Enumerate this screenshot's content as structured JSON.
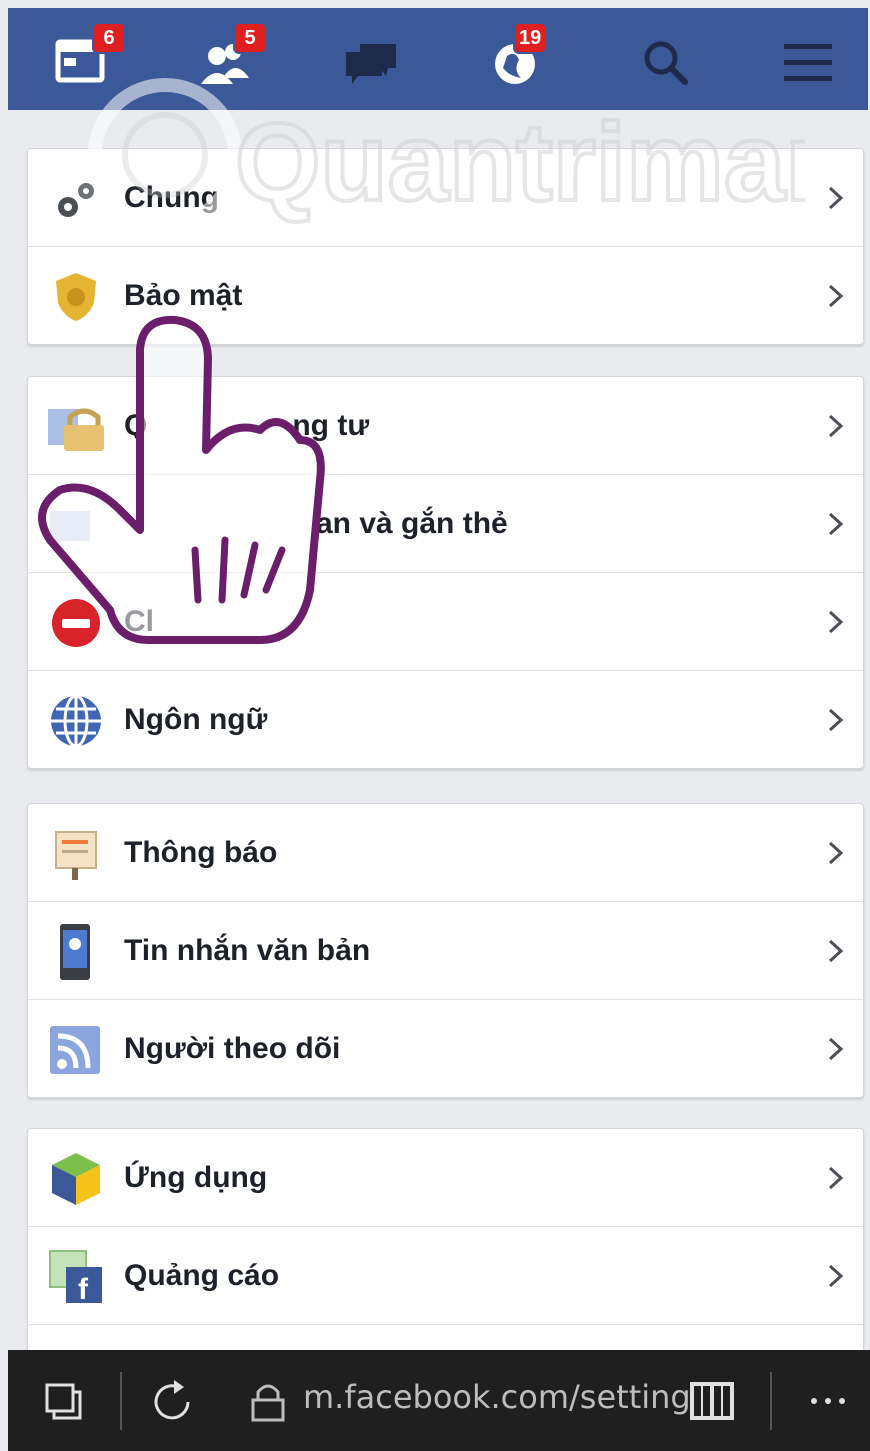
{
  "header": {
    "background": "#3b5998",
    "icons": [
      {
        "name": "news-feed-icon",
        "badge": "6"
      },
      {
        "name": "friend-requests-icon",
        "badge": "5"
      },
      {
        "name": "messages-icon",
        "badge": ""
      },
      {
        "name": "notifications-globe-icon",
        "badge": "19"
      },
      {
        "name": "search-icon",
        "badge": ""
      },
      {
        "name": "menu-icon",
        "badge": ""
      }
    ]
  },
  "watermark": {
    "text": "Quantrimang"
  },
  "settings_groups": [
    {
      "items": [
        {
          "label": "Chung",
          "icon": "gears-icon"
        },
        {
          "label": "Bảo mật",
          "icon": "security-badge-icon"
        }
      ]
    },
    {
      "items": [
        {
          "label": "Q",
          "extra": "ng tư",
          "icon": "privacy-lock-icon"
        },
        {
          "label": "an và gắn thẻ",
          "icon": "timeline-tagging-icon"
        },
        {
          "label": "Cl",
          "icon": "blocking-icon"
        },
        {
          "label": "Ngôn ngữ",
          "icon": "globe-icon"
        }
      ]
    },
    {
      "items": [
        {
          "label": "Thông báo",
          "icon": "notification-board-icon"
        },
        {
          "label": "Tin nhắn văn bản",
          "icon": "mobile-text-icon"
        },
        {
          "label": "Người theo dõi",
          "icon": "rss-followers-icon"
        }
      ]
    },
    {
      "items": [
        {
          "label": "Ứng dụng",
          "icon": "apps-cube-icon"
        },
        {
          "label": "Quảng cáo",
          "icon": "ads-facebook-icon"
        }
      ]
    }
  ],
  "browser": {
    "url": "m.facebook.com/setting",
    "buttons": [
      "tabs-icon",
      "refresh-icon",
      "lock-icon",
      "reading-view-icon",
      "more-icon"
    ]
  }
}
